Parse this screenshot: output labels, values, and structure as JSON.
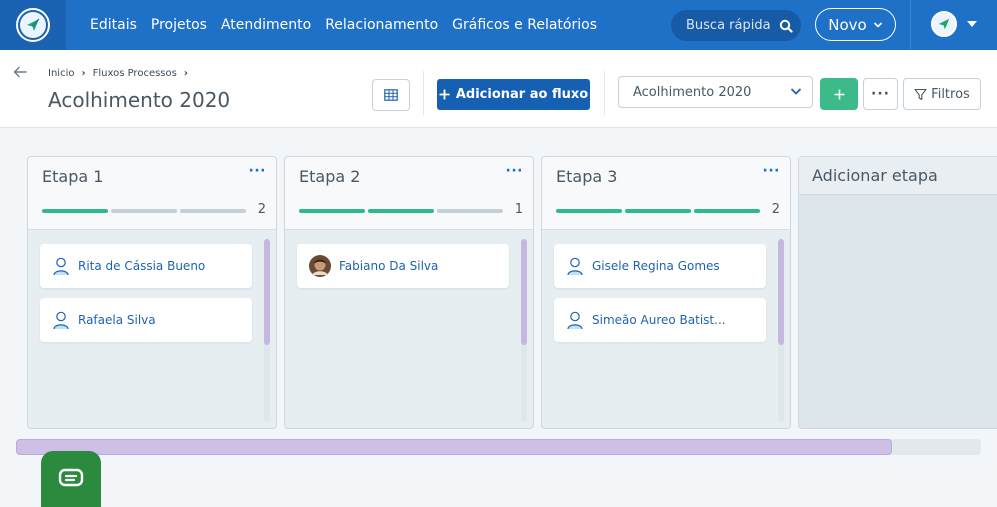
{
  "nav": {
    "links": [
      "Editais",
      "Projetos",
      "Atendimento",
      "Relacionamento",
      "Gráficos e Relatórios"
    ],
    "search_placeholder": "Busca rápida",
    "novo_label": "Novo",
    "brand_color": "#1f70c7"
  },
  "header": {
    "breadcrumb": [
      "Inicio",
      "Fluxos Processos"
    ],
    "title": "Acolhimento 2020",
    "add_label": "Adicionar ao fluxo",
    "select_value": "Acolhimento 2020",
    "filters_label": "Filtros",
    "more_label": "···"
  },
  "board": {
    "columns": [
      {
        "title": "Etapa 1",
        "count": "2",
        "progress_done": 1,
        "progress_total": 3,
        "cards": [
          {
            "name": "Rita de Cássia Bueno",
            "avatar": "person-icon"
          },
          {
            "name": "Rafaela Silva",
            "avatar": "person-icon"
          }
        ]
      },
      {
        "title": "Etapa 2",
        "count": "1",
        "progress_done": 2,
        "progress_total": 3,
        "cards": [
          {
            "name": "Fabiano Da Silva",
            "avatar": "photo-avatar"
          }
        ]
      },
      {
        "title": "Etapa 3",
        "count": "2",
        "progress_done": 3,
        "progress_total": 3,
        "cards": [
          {
            "name": "Gisele Regina Gomes",
            "avatar": "person-icon"
          },
          {
            "name": "Simeão Aureo Batist...",
            "avatar": "person-icon"
          }
        ]
      }
    ],
    "add_stage_label": "Adicionar etapa",
    "more_label": "···"
  }
}
